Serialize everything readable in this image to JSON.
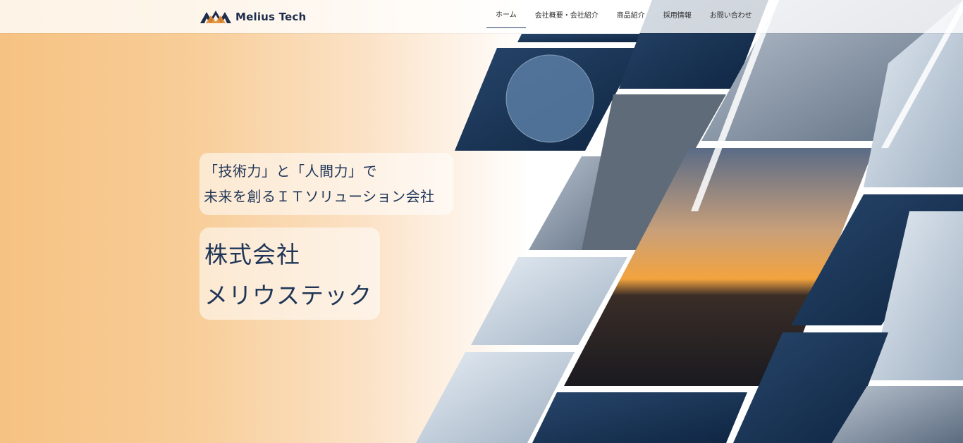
{
  "brand": {
    "name": "Melius Tech",
    "colors": {
      "navy": "#1e3557",
      "orange": "#e08a2c"
    }
  },
  "nav": {
    "items": [
      "ホーム",
      "会社概要・会社紹介",
      "商品紹介",
      "採用情報",
      "お問い合わせ"
    ],
    "active": "ホーム"
  },
  "hero": {
    "tagline": [
      "「技術力」と「人間力」で",
      "未来を創るＩＴソリューション会社"
    ],
    "company": [
      "株式会社",
      "メリウステック"
    ]
  }
}
